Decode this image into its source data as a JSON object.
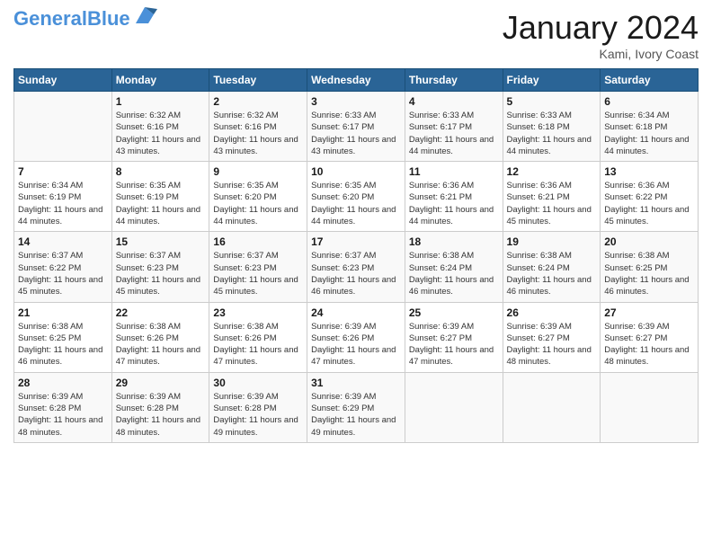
{
  "header": {
    "logo_text_general": "General",
    "logo_text_blue": "Blue",
    "month_title": "January 2024",
    "subtitle": "Kami, Ivory Coast"
  },
  "calendar": {
    "days_of_week": [
      "Sunday",
      "Monday",
      "Tuesday",
      "Wednesday",
      "Thursday",
      "Friday",
      "Saturday"
    ],
    "weeks": [
      [
        {
          "day": "",
          "info": ""
        },
        {
          "day": "1",
          "info": "Sunrise: 6:32 AM\nSunset: 6:16 PM\nDaylight: 11 hours and 43 minutes."
        },
        {
          "day": "2",
          "info": "Sunrise: 6:32 AM\nSunset: 6:16 PM\nDaylight: 11 hours and 43 minutes."
        },
        {
          "day": "3",
          "info": "Sunrise: 6:33 AM\nSunset: 6:17 PM\nDaylight: 11 hours and 43 minutes."
        },
        {
          "day": "4",
          "info": "Sunrise: 6:33 AM\nSunset: 6:17 PM\nDaylight: 11 hours and 44 minutes."
        },
        {
          "day": "5",
          "info": "Sunrise: 6:33 AM\nSunset: 6:18 PM\nDaylight: 11 hours and 44 minutes."
        },
        {
          "day": "6",
          "info": "Sunrise: 6:34 AM\nSunset: 6:18 PM\nDaylight: 11 hours and 44 minutes."
        }
      ],
      [
        {
          "day": "7",
          "info": "Sunrise: 6:34 AM\nSunset: 6:19 PM\nDaylight: 11 hours and 44 minutes."
        },
        {
          "day": "8",
          "info": "Sunrise: 6:35 AM\nSunset: 6:19 PM\nDaylight: 11 hours and 44 minutes."
        },
        {
          "day": "9",
          "info": "Sunrise: 6:35 AM\nSunset: 6:20 PM\nDaylight: 11 hours and 44 minutes."
        },
        {
          "day": "10",
          "info": "Sunrise: 6:35 AM\nSunset: 6:20 PM\nDaylight: 11 hours and 44 minutes."
        },
        {
          "day": "11",
          "info": "Sunrise: 6:36 AM\nSunset: 6:21 PM\nDaylight: 11 hours and 44 minutes."
        },
        {
          "day": "12",
          "info": "Sunrise: 6:36 AM\nSunset: 6:21 PM\nDaylight: 11 hours and 45 minutes."
        },
        {
          "day": "13",
          "info": "Sunrise: 6:36 AM\nSunset: 6:22 PM\nDaylight: 11 hours and 45 minutes."
        }
      ],
      [
        {
          "day": "14",
          "info": "Sunrise: 6:37 AM\nSunset: 6:22 PM\nDaylight: 11 hours and 45 minutes."
        },
        {
          "day": "15",
          "info": "Sunrise: 6:37 AM\nSunset: 6:23 PM\nDaylight: 11 hours and 45 minutes."
        },
        {
          "day": "16",
          "info": "Sunrise: 6:37 AM\nSunset: 6:23 PM\nDaylight: 11 hours and 45 minutes."
        },
        {
          "day": "17",
          "info": "Sunrise: 6:37 AM\nSunset: 6:23 PM\nDaylight: 11 hours and 46 minutes."
        },
        {
          "day": "18",
          "info": "Sunrise: 6:38 AM\nSunset: 6:24 PM\nDaylight: 11 hours and 46 minutes."
        },
        {
          "day": "19",
          "info": "Sunrise: 6:38 AM\nSunset: 6:24 PM\nDaylight: 11 hours and 46 minutes."
        },
        {
          "day": "20",
          "info": "Sunrise: 6:38 AM\nSunset: 6:25 PM\nDaylight: 11 hours and 46 minutes."
        }
      ],
      [
        {
          "day": "21",
          "info": "Sunrise: 6:38 AM\nSunset: 6:25 PM\nDaylight: 11 hours and 46 minutes."
        },
        {
          "day": "22",
          "info": "Sunrise: 6:38 AM\nSunset: 6:26 PM\nDaylight: 11 hours and 47 minutes."
        },
        {
          "day": "23",
          "info": "Sunrise: 6:38 AM\nSunset: 6:26 PM\nDaylight: 11 hours and 47 minutes."
        },
        {
          "day": "24",
          "info": "Sunrise: 6:39 AM\nSunset: 6:26 PM\nDaylight: 11 hours and 47 minutes."
        },
        {
          "day": "25",
          "info": "Sunrise: 6:39 AM\nSunset: 6:27 PM\nDaylight: 11 hours and 47 minutes."
        },
        {
          "day": "26",
          "info": "Sunrise: 6:39 AM\nSunset: 6:27 PM\nDaylight: 11 hours and 48 minutes."
        },
        {
          "day": "27",
          "info": "Sunrise: 6:39 AM\nSunset: 6:27 PM\nDaylight: 11 hours and 48 minutes."
        }
      ],
      [
        {
          "day": "28",
          "info": "Sunrise: 6:39 AM\nSunset: 6:28 PM\nDaylight: 11 hours and 48 minutes."
        },
        {
          "day": "29",
          "info": "Sunrise: 6:39 AM\nSunset: 6:28 PM\nDaylight: 11 hours and 48 minutes."
        },
        {
          "day": "30",
          "info": "Sunrise: 6:39 AM\nSunset: 6:28 PM\nDaylight: 11 hours and 49 minutes."
        },
        {
          "day": "31",
          "info": "Sunrise: 6:39 AM\nSunset: 6:29 PM\nDaylight: 11 hours and 49 minutes."
        },
        {
          "day": "",
          "info": ""
        },
        {
          "day": "",
          "info": ""
        },
        {
          "day": "",
          "info": ""
        }
      ]
    ]
  }
}
